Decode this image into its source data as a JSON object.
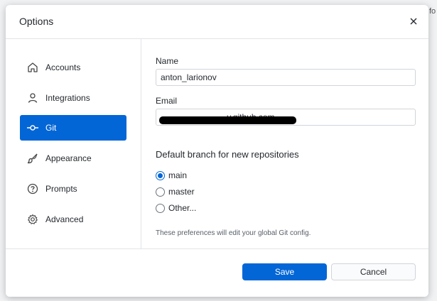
{
  "dialog": {
    "title": "Options"
  },
  "sidebar": {
    "items": [
      {
        "label": "Accounts",
        "icon": "home-icon",
        "active": false
      },
      {
        "label": "Integrations",
        "icon": "person-icon",
        "active": false
      },
      {
        "label": "Git",
        "icon": "git-commit-icon",
        "active": true
      },
      {
        "label": "Appearance",
        "icon": "paintbrush-icon",
        "active": false
      },
      {
        "label": "Prompts",
        "icon": "question-icon",
        "active": false
      },
      {
        "label": "Advanced",
        "icon": "gear-icon",
        "active": false
      }
    ]
  },
  "git": {
    "name_label": "Name",
    "name_value": "anton_larionov",
    "email_label": "Email",
    "email_value": "                            y.github.com",
    "branch_heading": "Default branch for new repositories",
    "branch_options": [
      {
        "label": "main",
        "checked": true
      },
      {
        "label": "master",
        "checked": false
      },
      {
        "label": "Other...",
        "checked": false
      }
    ],
    "hint": "These preferences will edit your global Git config."
  },
  "footer": {
    "save_label": "Save",
    "cancel_label": "Cancel"
  },
  "background": {
    "fragment": "fo"
  },
  "colors": {
    "accent": "#0366d6",
    "border": "#e1e4e8"
  }
}
